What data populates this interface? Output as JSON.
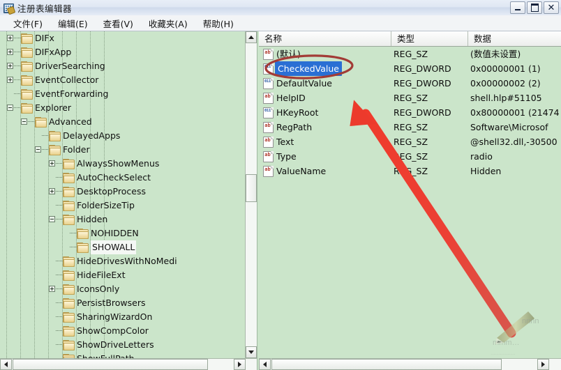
{
  "window": {
    "title": "注册表编辑器",
    "icon": "registry-editor-icon",
    "buttons": {
      "minimize": "_",
      "maximize": "❐",
      "close": "✕"
    }
  },
  "menu": {
    "items": [
      {
        "label": "文件(F)"
      },
      {
        "label": "编辑(E)"
      },
      {
        "label": "查看(V)"
      },
      {
        "label": "收藏夹(A)"
      },
      {
        "label": "帮助(H)"
      }
    ]
  },
  "tree": {
    "selected": "SHOWALL",
    "nodes": [
      {
        "label": "DIFx",
        "depth": 1,
        "toggle": "plus",
        "selected": false,
        "partial": false
      },
      {
        "label": "DIFxApp",
        "depth": 1,
        "toggle": "plus",
        "selected": false,
        "partial": false
      },
      {
        "label": "DriverSearching",
        "depth": 1,
        "toggle": "plus",
        "selected": false,
        "partial": false
      },
      {
        "label": "EventCollector",
        "depth": 1,
        "toggle": "plus",
        "selected": false,
        "partial": false
      },
      {
        "label": "EventForwarding",
        "depth": 1,
        "toggle": "none",
        "selected": false,
        "partial": false
      },
      {
        "label": "Explorer",
        "depth": 1,
        "toggle": "minus",
        "selected": false,
        "partial": false
      },
      {
        "label": "Advanced",
        "depth": 2,
        "toggle": "minus",
        "selected": false,
        "partial": false
      },
      {
        "label": "DelayedApps",
        "depth": 3,
        "toggle": "none",
        "selected": false,
        "partial": false
      },
      {
        "label": "Folder",
        "depth": 3,
        "toggle": "minus",
        "selected": false,
        "partial": false
      },
      {
        "label": "AlwaysShowMenus",
        "depth": 4,
        "toggle": "plus",
        "selected": false,
        "partial": false
      },
      {
        "label": "AutoCheckSelect",
        "depth": 4,
        "toggle": "none",
        "selected": false,
        "partial": false
      },
      {
        "label": "DesktopProcess",
        "depth": 4,
        "toggle": "plus",
        "selected": false,
        "partial": false
      },
      {
        "label": "FolderSizeTip",
        "depth": 4,
        "toggle": "none",
        "selected": false,
        "partial": false
      },
      {
        "label": "Hidden",
        "depth": 4,
        "toggle": "minus",
        "selected": false,
        "partial": false
      },
      {
        "label": "NOHIDDEN",
        "depth": 5,
        "toggle": "none",
        "selected": false,
        "partial": false
      },
      {
        "label": "SHOWALL",
        "depth": 5,
        "toggle": "none",
        "selected": true,
        "partial": false
      },
      {
        "label": "HideDrivesWithNoMedi",
        "depth": 4,
        "toggle": "none",
        "selected": false,
        "partial": false
      },
      {
        "label": "HideFileExt",
        "depth": 4,
        "toggle": "none",
        "selected": false,
        "partial": false
      },
      {
        "label": "IconsOnly",
        "depth": 4,
        "toggle": "plus",
        "selected": false,
        "partial": false
      },
      {
        "label": "PersistBrowsers",
        "depth": 4,
        "toggle": "none",
        "selected": false,
        "partial": false
      },
      {
        "label": "SharingWizardOn",
        "depth": 4,
        "toggle": "none",
        "selected": false,
        "partial": false
      },
      {
        "label": "ShowCompColor",
        "depth": 4,
        "toggle": "none",
        "selected": false,
        "partial": false
      },
      {
        "label": "ShowDriveLetters",
        "depth": 4,
        "toggle": "none",
        "selected": false,
        "partial": false
      },
      {
        "label": "ShowFullPath",
        "depth": 4,
        "toggle": "none",
        "selected": false,
        "partial": true
      }
    ]
  },
  "list": {
    "columns": [
      {
        "label": "名称"
      },
      {
        "label": "类型"
      },
      {
        "label": "数据"
      }
    ],
    "rows": [
      {
        "name": "(默认)",
        "type": "REG_SZ",
        "data": "(数值未设置)",
        "icon": "string-value-icon",
        "glyph": "ab",
        "kind": "sz",
        "selected": false
      },
      {
        "name": "CheckedValue",
        "type": "REG_DWORD",
        "data": "0x00000001 (1)",
        "icon": "dword-value-icon",
        "glyph": "011",
        "kind": "dw",
        "selected": true
      },
      {
        "name": "DefaultValue",
        "type": "REG_DWORD",
        "data": "0x00000002 (2)",
        "icon": "dword-value-icon",
        "glyph": "011",
        "kind": "dw",
        "selected": false
      },
      {
        "name": "HelpID",
        "type": "REG_SZ",
        "data": "shell.hlp#51105",
        "icon": "string-value-icon",
        "glyph": "ab",
        "kind": "sz",
        "selected": false
      },
      {
        "name": "HKeyRoot",
        "type": "REG_DWORD",
        "data": "0x80000001 (21474",
        "icon": "dword-value-icon",
        "glyph": "011",
        "kind": "dw",
        "selected": false
      },
      {
        "name": "RegPath",
        "type": "REG_SZ",
        "data": "Software\\Microsof",
        "icon": "string-value-icon",
        "glyph": "ab",
        "kind": "sz",
        "selected": false
      },
      {
        "name": "Text",
        "type": "REG_SZ",
        "data": "@shell32.dll,-30500",
        "icon": "string-value-icon",
        "glyph": "ab",
        "kind": "sz",
        "selected": false
      },
      {
        "name": "Type",
        "type": "REG_SZ",
        "data": "radio",
        "icon": "string-value-icon",
        "glyph": "ab",
        "kind": "sz",
        "selected": false
      },
      {
        "name": "ValueName",
        "type": "REG_SZ",
        "data": "Hidden",
        "icon": "string-value-icon",
        "glyph": "ab",
        "kind": "sz",
        "selected": false
      }
    ]
  },
  "annotations": {
    "ellipse": {
      "target": "CheckedValue",
      "color": "#a23b36"
    },
    "arrow": {
      "target": "CheckedValue",
      "color": "#e8342a"
    },
    "watermark": {
      "present": true
    }
  },
  "scrollbars": {
    "tree_vertical": {
      "up": "▲",
      "down": "▼"
    },
    "tree_horizontal": {
      "left": "◀",
      "right": "▶"
    },
    "list_horizontal": {
      "left": "◀"
    }
  }
}
